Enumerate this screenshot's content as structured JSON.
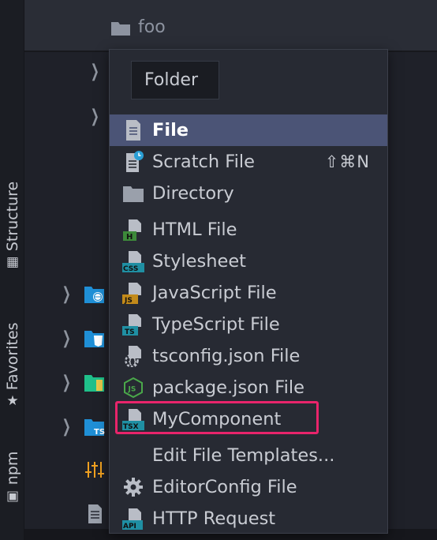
{
  "tool_strip": {
    "structure_label": "Structure",
    "favorites_label": "Favorites",
    "npm_label": "npm"
  },
  "tree": {
    "header_folder": "foo"
  },
  "new_menu": {
    "title": "Folder",
    "items": [
      {
        "label": "File",
        "icon": "file-icon",
        "selected": true
      },
      {
        "label": "Scratch File",
        "icon": "scratch-file-icon",
        "shortcut": "⇧⌘N"
      },
      {
        "label": "Directory",
        "icon": "folder-icon"
      },
      {
        "label": "HTML File",
        "icon": "html-file-icon"
      },
      {
        "label": "Stylesheet",
        "icon": "css-file-icon"
      },
      {
        "label": "JavaScript File",
        "icon": "js-file-icon"
      },
      {
        "label": "TypeScript File",
        "icon": "ts-file-icon"
      },
      {
        "label": "tsconfig.json File",
        "icon": "tsconfig-icon"
      },
      {
        "label": "package.json File",
        "icon": "nodejs-icon"
      },
      {
        "label": "MyComponent",
        "icon": "tsx-file-icon",
        "highlighted": true
      },
      {
        "label": "Edit File Templates...",
        "icon": ""
      },
      {
        "label": "EditorConfig File",
        "icon": "gear-icon"
      },
      {
        "label": "HTTP Request",
        "icon": "api-file-icon"
      }
    ],
    "icon_badges": {
      "html": "H",
      "css": "CSS",
      "js": "JS",
      "ts": "TS",
      "tsx": "TSX",
      "api": "API",
      "tsconfig": "{}",
      "node": "JS"
    }
  },
  "colors": {
    "selection": "#4b5476",
    "highlight_border": "#e8246b",
    "html_badge": "#3d8a3a",
    "css_badge": "#1f8fa3",
    "js_badge": "#c28a1a",
    "ts_badge": "#1f8fa3"
  }
}
